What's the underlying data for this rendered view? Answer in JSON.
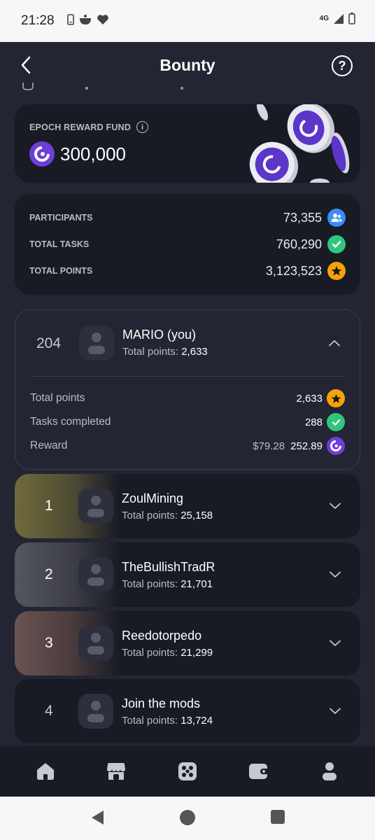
{
  "status_bar": {
    "time": "21:28",
    "network": "4G"
  },
  "header": {
    "title": "Bounty",
    "help_label": "?"
  },
  "fund": {
    "label": "EPOCH REWARD FUND",
    "info": "i",
    "amount": "300,000"
  },
  "stats": [
    {
      "label": "PARTICIPANTS",
      "value": "73,355",
      "icon": "users-icon",
      "color": "#3b8cf5"
    },
    {
      "label": "TOTAL TASKS",
      "value": "760,290",
      "icon": "check-icon",
      "color": "#2fc77d"
    },
    {
      "label": "TOTAL POINTS",
      "value": "3,123,523",
      "icon": "star-icon",
      "color": "#f5a20b"
    }
  ],
  "me": {
    "rank": "204",
    "name": "MARIO (you)",
    "points_label": "Total points:",
    "points": "2,633",
    "details": {
      "total_points_label": "Total points",
      "total_points": "2,633",
      "tasks_label": "Tasks completed",
      "tasks": "288",
      "reward_label": "Reward",
      "reward_usd": "$79.28",
      "reward_tokens": "252.89"
    }
  },
  "leaderboard": [
    {
      "rank": "1",
      "name": "ZoulMining",
      "points_label": "Total points:",
      "points": "25,158",
      "tint": "#6f6a3a"
    },
    {
      "rank": "2",
      "name": "TheBullishTradR",
      "points_label": "Total points:",
      "points": "21,701",
      "tint": "#55565f"
    },
    {
      "rank": "3",
      "name": "Reedotorpedo",
      "points_label": "Total points:",
      "points": "21,299",
      "tint": "#6b5352"
    },
    {
      "rank": "4",
      "name": "Join the mods",
      "points_label": "Total points:",
      "points": "13,724",
      "tint": ""
    }
  ],
  "bottom_nav": [
    "home-icon",
    "store-icon",
    "dice-icon",
    "wallet-icon",
    "profile-icon"
  ],
  "colors": {
    "background": "#232532",
    "card": "#181a24",
    "accent_purple": "#6c3fd8"
  }
}
